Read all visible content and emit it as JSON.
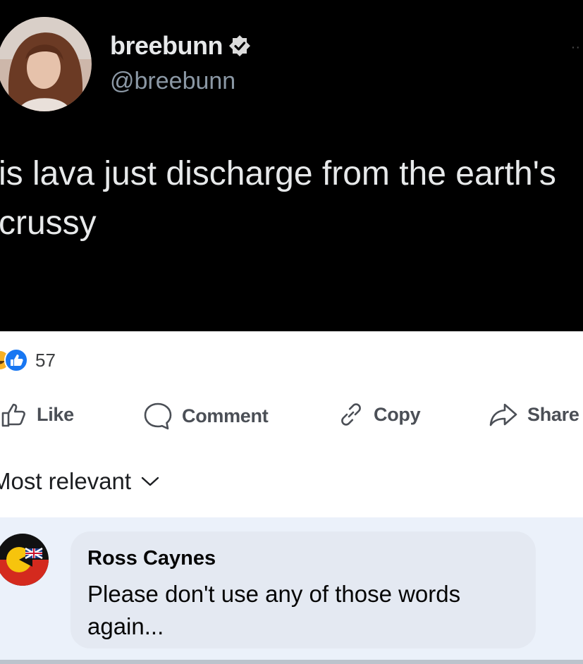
{
  "post": {
    "display_name": "breebunn",
    "handle": "@breebunn",
    "text": "is lava just discharge from the earth's crussy",
    "more_glyph": "··"
  },
  "reactions": {
    "count": "57"
  },
  "actions": [
    {
      "label": "Like",
      "icon": "thumbs-up-icon"
    },
    {
      "label": "Comment",
      "icon": "speech-bubble-icon"
    },
    {
      "label": "Copy",
      "icon": "link-icon"
    },
    {
      "label": "Share",
      "icon": "share-arrow-icon"
    }
  ],
  "sort": {
    "label": "Most relevant"
  },
  "comment": {
    "author": "Ross Caynes",
    "text": "Please don't use any of those words again..."
  },
  "colors": {
    "tweet_bg": "#000000",
    "like_blue": "#1877f2",
    "comment_bg": "#ebf1fa"
  }
}
